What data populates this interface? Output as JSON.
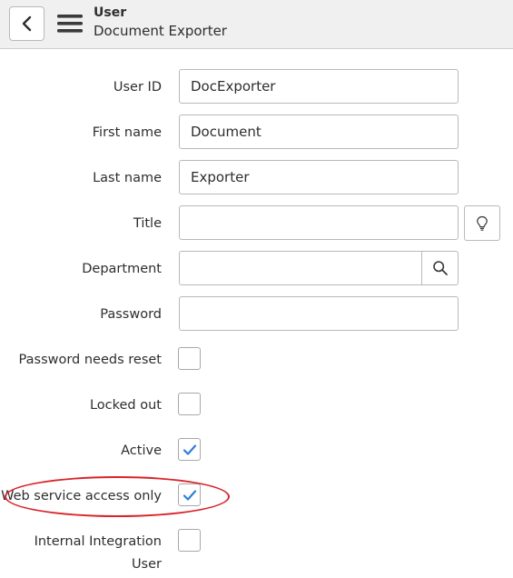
{
  "header": {
    "title": "User",
    "subtitle": "Document Exporter",
    "back_icon": "chevron-left-icon",
    "menu_icon": "hamburger-menu-icon"
  },
  "form": {
    "user_id": {
      "label": "User ID",
      "value": "DocExporter"
    },
    "first_name": {
      "label": "First name",
      "value": "Document"
    },
    "last_name": {
      "label": "Last name",
      "value": "Exporter"
    },
    "title": {
      "label": "Title",
      "value": "",
      "suggest_icon": "lightbulb-icon"
    },
    "department": {
      "label": "Department",
      "value": "",
      "lookup_icon": "search-icon"
    },
    "password": {
      "label": "Password",
      "value": ""
    },
    "password_needs_reset": {
      "label": "Password needs reset",
      "checked": false
    },
    "locked_out": {
      "label": "Locked out",
      "checked": false
    },
    "active": {
      "label": "Active",
      "checked": true
    },
    "web_service_access_only": {
      "label": "Web service access only",
      "checked": true,
      "highlighted": true
    },
    "internal_integration_user": {
      "label_line1": "Internal Integration",
      "label_line2": "User",
      "checked": false
    }
  },
  "colors": {
    "header_bg": "#f0f0f0",
    "check_color": "#2f7dd6",
    "highlight_color": "#d9242a",
    "border": "#b9b9b9"
  }
}
